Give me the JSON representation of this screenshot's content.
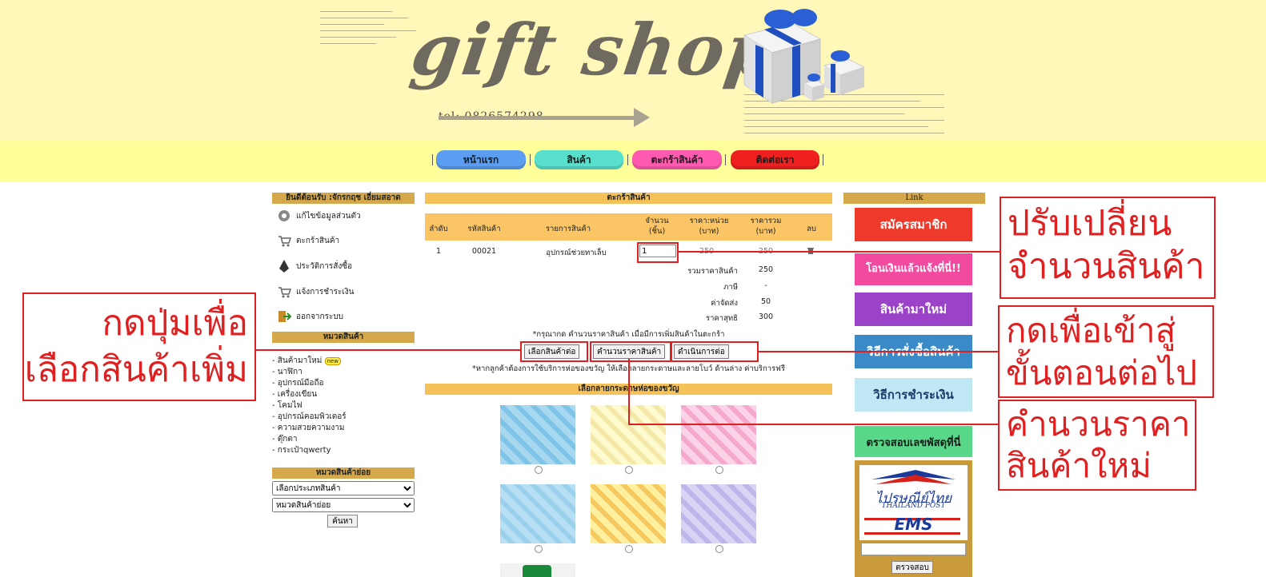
{
  "header": {
    "logo": "gift shop",
    "tel": "tel: 0826574298"
  },
  "nav": [
    "หน้าแรก",
    "สินค้า",
    "ตะกร้าสินค้า",
    "ติดต่อเรา"
  ],
  "sidebar": {
    "welcome": "ยินดีต้อนรับ :จักรกฤช เอี่ยมสอาด",
    "menu": [
      "แก้ไขข้อมูลส่วนตัว",
      "ตะกร้าสินค้า",
      "ประวัติการสั่งซื้อ",
      "แจ้งการชำระเงิน",
      "ออกจากระบบ"
    ],
    "category_title": "หมวดสินค้า",
    "categories": [
      "- สินค้ามาใหม่",
      "- นาฬิกา",
      "- อุปกรณ์มือถือ",
      "- เครื่องเขียน",
      "- โคมไฟ",
      "- อุปกรณ์คอมพิวเตอร์",
      "- ความสวยความงาม",
      "- ตุ๊กตา",
      "- กระเป๋าqwerty"
    ],
    "new_badge": "new",
    "subcategory_title": "หมวดสินค้าย่อย",
    "select_type": "เลือกประเภทสินค้า",
    "select_sub": "หมวดสินค้าย่อย",
    "search_label": "ค้นหา"
  },
  "cart": {
    "title": "ตะกร้าสินค้า",
    "headers": [
      "ลำดับ",
      "รหัสสินค้า",
      "รายการสินค้า",
      "จำนวน (ชิ้น)",
      "ราคา:หน่วย (บาท)",
      "ราคารวม (บาท)",
      "ลบ"
    ],
    "row": {
      "no": "1",
      "code": "00021",
      "name": "อุปกรณ์ช่วยทาเล็บ",
      "qty": "1",
      "unit_price": "250",
      "total": "250"
    },
    "summary": [
      {
        "label": "รวมราคาสินค้า",
        "value": "250"
      },
      {
        "label": "ภาษี",
        "value": "-"
      },
      {
        "label": "ค่าจัดส่ง",
        "value": "50"
      },
      {
        "label": "ราคาสุทธิ",
        "value": "300"
      }
    ],
    "note1": "*กรุณากด คำนวนราคาสินค้า เมื่อมีการเพิ่มสินค้าในตะกร้า",
    "btn_continue": "เลือกสินค้าต่อ",
    "btn_calc": "คำนวนราคาสินค้า",
    "btn_proceed": "ดำเนินการต่อ",
    "note2": "*หากลูกค้าต้องการใช้บริการห่อของขวัญ ให้เลือกลายกระดาษและลายโบว์ ด้านล่าง ค่าบริการฟรี",
    "wrap_title": "เลือกลายกระดาษห่อของขวัญ"
  },
  "right": {
    "link_title": "Link",
    "buttons": [
      "สมัครสมาชิก",
      "โอนเงินแล้วแจ้งที่นี่!!",
      "สินค้ามาใหม่",
      "วิธีการสั่งซื้อสินค้า",
      "วิธีการชำระเงิน",
      "ตรวจสอบเลขพัสดุที่นี่"
    ],
    "post_logo_line1": "ไปรษณีย์ไทย",
    "post_logo_line2": "THAILAND POST",
    "ems": "EMS",
    "check_label": "ตรวจสอบ"
  },
  "annotations": {
    "qty_line1": "ปรับเปลี่ยน",
    "qty_line2": "จำนวนสินค้า",
    "continue_line1": "กดปุ่มเพื่อ",
    "continue_line2": "เลือกสินค้าเพิ่ม",
    "proceed_line1": "กดเพื่อเข้าสู่",
    "proceed_line2": "ขั้นตอนต่อไป",
    "calc_line1": "คำนวนราคา",
    "calc_line2": "สินค้าใหม่"
  },
  "colors": {
    "annotation_red": "#e02020",
    "gold": "#d4a84b",
    "banner": "#fff8b8"
  }
}
